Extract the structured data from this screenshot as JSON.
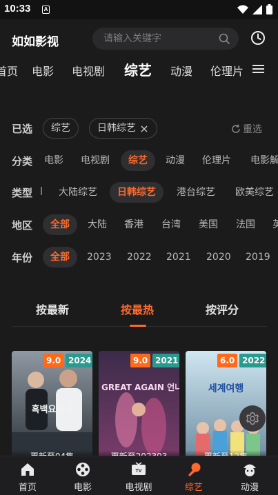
{
  "status_bar": {
    "time": "10:33",
    "notif_letter": "A"
  },
  "header": {
    "app_title": "如如影视",
    "search_placeholder": "请输入关键字"
  },
  "main_tabs": [
    {
      "label": "首页"
    },
    {
      "label": "电影"
    },
    {
      "label": "电视剧"
    },
    {
      "label": "综艺",
      "active": true
    },
    {
      "label": "动漫"
    },
    {
      "label": "伦理片"
    }
  ],
  "filters": {
    "selected": {
      "label": "已选",
      "items": [
        "综艺",
        "日韩综艺"
      ],
      "reset": "重选"
    },
    "category": {
      "label": "分类",
      "items": [
        "电影",
        "电视剧",
        "综艺",
        "动漫",
        "伦理片",
        "电影解"
      ],
      "active": "综艺"
    },
    "type": {
      "label": "类型",
      "items": [
        "大陆综艺",
        "日韩综艺",
        "港台综艺",
        "欧美综艺"
      ],
      "active": "日韩综艺"
    },
    "region": {
      "label": "地区",
      "items": [
        "全部",
        "大陆",
        "香港",
        "台湾",
        "美国",
        "法国",
        "英"
      ],
      "active": "全部"
    },
    "year": {
      "label": "年份",
      "items": [
        "全部",
        "2023",
        "2022",
        "2021",
        "2020",
        "2019"
      ],
      "active": "全部"
    }
  },
  "sort_tabs": [
    {
      "label": "按最新"
    },
    {
      "label": "按最热",
      "active": true
    },
    {
      "label": "按评分"
    }
  ],
  "cards": [
    {
      "score": "9.0",
      "year": "2024",
      "update": "更新至04集",
      "poster_text": "흑백요리사",
      "colors": {
        "top": "#8f99a3",
        "bottom": "#2b3036"
      }
    },
    {
      "score": "9.0",
      "year": "2021",
      "update": "更新至202303",
      "poster_text": "GREAT AGAIN 언니들",
      "colors": {
        "top": "#3c2b4a",
        "bottom": "#7a3d6a"
      }
    },
    {
      "score": "6.0",
      "year": "2022",
      "update": "更新至12集",
      "poster_text": "세계여행",
      "colors": {
        "top": "#cfe7f1",
        "bottom": "#6d8aa0"
      }
    }
  ],
  "bottom_nav": [
    {
      "label": "首页",
      "icon": "home-icon"
    },
    {
      "label": "电影",
      "icon": "film-reel-icon"
    },
    {
      "label": "电视剧",
      "icon": "tv-icon"
    },
    {
      "label": "综艺",
      "icon": "microphone-icon",
      "active": true
    },
    {
      "label": "动漫",
      "icon": "anime-icon"
    }
  ],
  "accent_color": "#ff6a2c"
}
